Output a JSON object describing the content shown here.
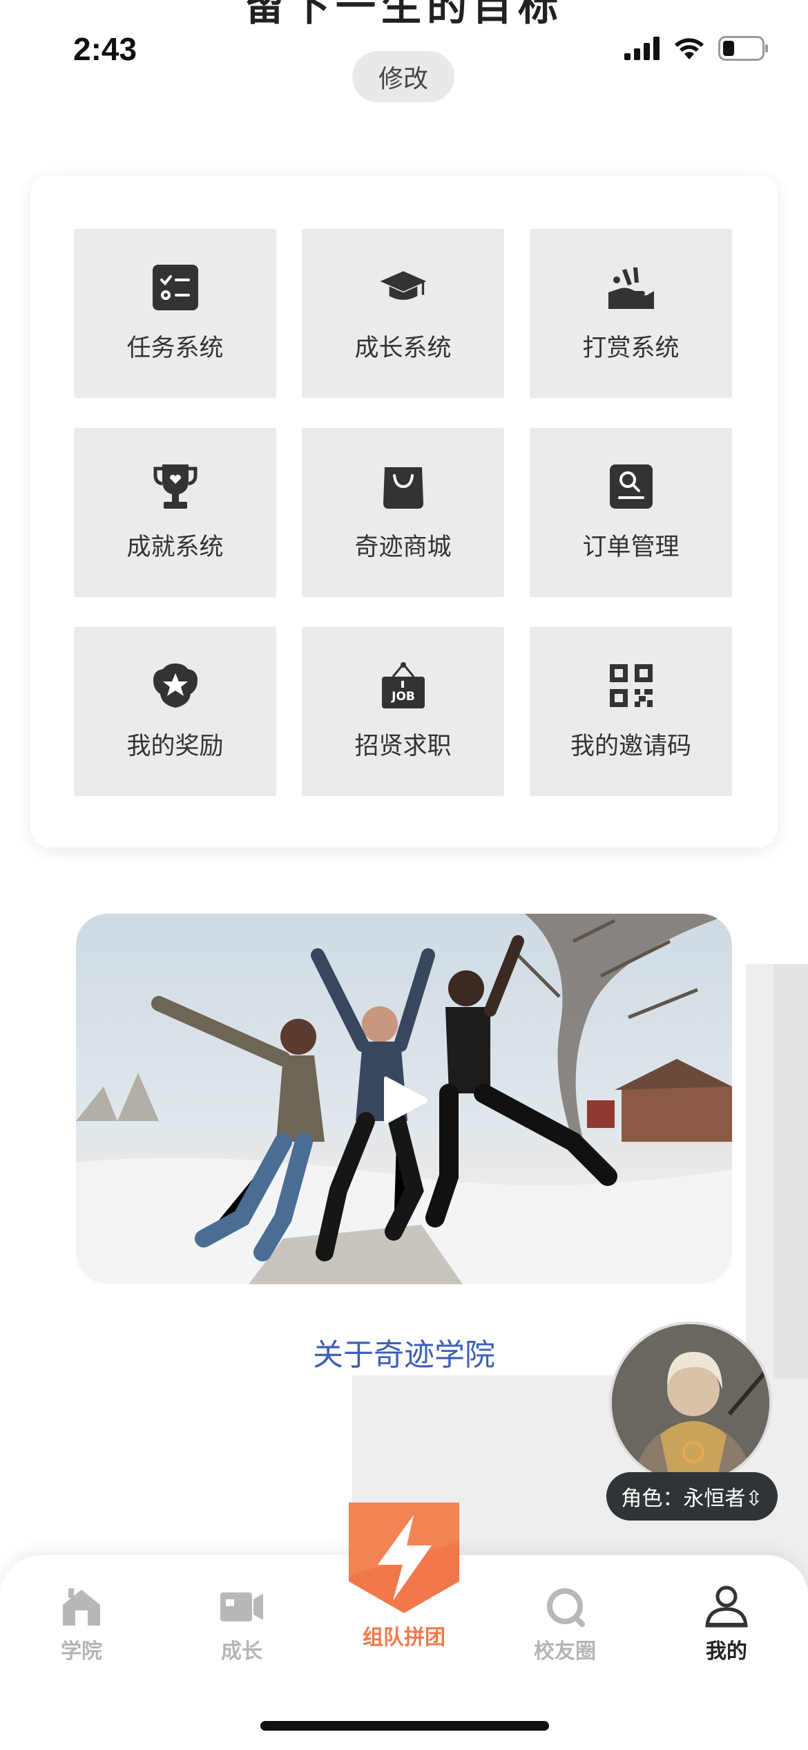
{
  "header": {
    "clipped_title": "留下一生的目标",
    "edit_label": "修改"
  },
  "status_bar": {
    "time": "2:43",
    "icons": [
      "signal-icon",
      "wifi-icon",
      "battery-icon"
    ]
  },
  "menu": {
    "items": [
      {
        "label": "任务系统",
        "icon": "task-list-icon"
      },
      {
        "label": "成长系统",
        "icon": "graduation-cap-icon"
      },
      {
        "label": "打赏系统",
        "icon": "tip-hand-icon"
      },
      {
        "label": "成就系统",
        "icon": "trophy-icon"
      },
      {
        "label": "奇迹商城",
        "icon": "shopping-bag-icon"
      },
      {
        "label": "订单管理",
        "icon": "order-icon"
      },
      {
        "label": "我的奖励",
        "icon": "star-badge-icon"
      },
      {
        "label": "招贤求职",
        "icon": "job-sign-icon"
      },
      {
        "label": "我的邀请码",
        "icon": "qr-code-icon"
      }
    ]
  },
  "video": {
    "about_label": "关于奇迹学院",
    "play_icon": "play-icon"
  },
  "role": {
    "label": "角色：永恒者⇳"
  },
  "tab_bar": {
    "tabs": [
      {
        "label": "学院",
        "icon": "home-icon"
      },
      {
        "label": "成长",
        "icon": "video-camera-icon"
      },
      {
        "label": "组队拼团",
        "icon": "lightning-icon"
      },
      {
        "label": "校友圈",
        "icon": "circle-search-icon"
      },
      {
        "label": "我的",
        "icon": "user-icon"
      }
    ],
    "active": "我的"
  },
  "colors": {
    "accent": "#f07a4a",
    "link": "#3e5fb7",
    "tile": "#ebebeb",
    "icon": "#333333"
  }
}
